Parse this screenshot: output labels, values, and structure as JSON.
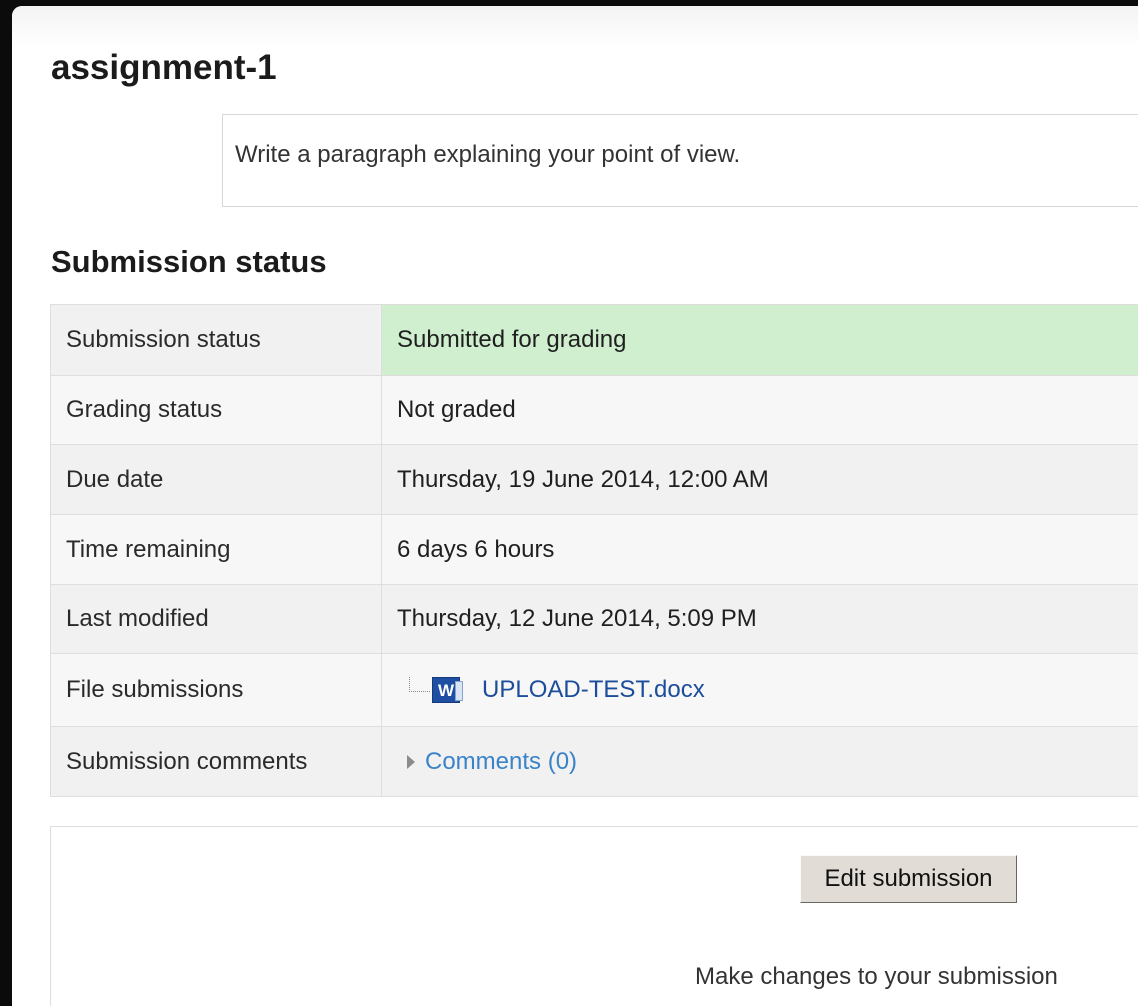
{
  "page": {
    "title": "assignment-1",
    "intro": "Write a paragraph explaining your point of view."
  },
  "submission": {
    "heading": "Submission status",
    "rows": [
      {
        "label": "Submission status",
        "value": "Submitted for grading"
      },
      {
        "label": "Grading status",
        "value": "Not graded"
      },
      {
        "label": "Due date",
        "value": "Thursday, 19 June 2014, 12:00 AM"
      },
      {
        "label": "Time remaining",
        "value": "6 days 6 hours"
      },
      {
        "label": "Last modified",
        "value": "Thursday, 12 June 2014, 5:09 PM"
      },
      {
        "label": "File submissions",
        "file_name": "UPLOAD-TEST.docx",
        "file_icon": "word-document-icon",
        "icon_letter": "W"
      },
      {
        "label": "Submission comments",
        "link": "Comments (0)"
      }
    ],
    "colors": {
      "submitted_bg": "#cfefcf",
      "link": "#1c4d9c",
      "comments_link": "#3b83c9"
    }
  },
  "actions": {
    "edit_button": "Edit submission",
    "help": "Make changes to your submission"
  }
}
